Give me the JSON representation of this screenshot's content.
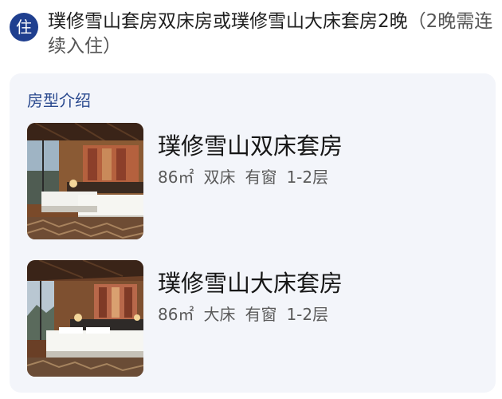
{
  "header": {
    "badge": "住",
    "title": "璞修雪山套房双床房或璞修雪山大床套房2晚",
    "note": "（2晚需连续入住）"
  },
  "section": {
    "label": "房型介绍"
  },
  "rooms": [
    {
      "name": "璞修雪山双床套房",
      "area": "86㎡",
      "bed": "双床",
      "window": "有窗",
      "floor": "1-2层"
    },
    {
      "name": "璞修雪山大床套房",
      "area": "86㎡",
      "bed": "大床",
      "window": "有窗",
      "floor": "1-2层"
    }
  ],
  "colors": {
    "badge_bg": "#1f3f8f",
    "section_label": "#2b4a8f",
    "card_bg": "#f3f5fa"
  }
}
